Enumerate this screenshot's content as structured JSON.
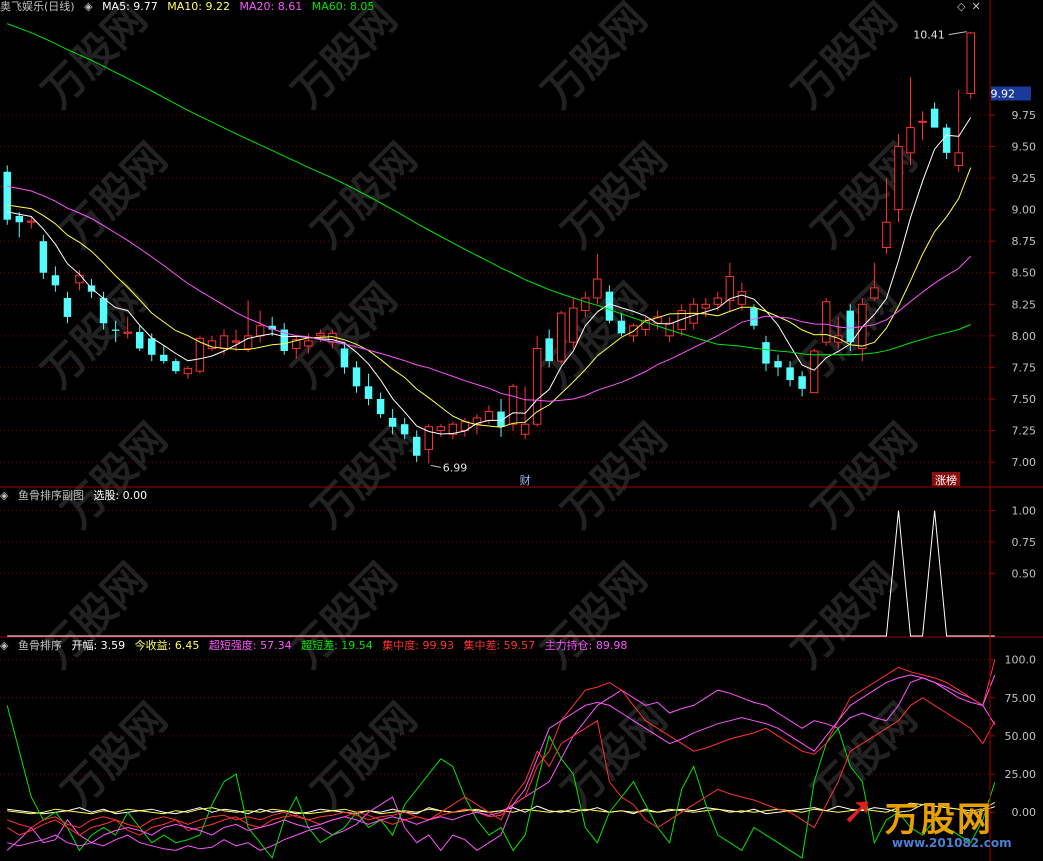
{
  "colors": {
    "up": "#ff3232",
    "down": "#54fcfc",
    "ma5": "#ffffff",
    "ma10": "#ffff54",
    "ma20": "#ff54ff",
    "ma60": "#00e600",
    "grid": "#7a0000",
    "frame": "#a00000",
    "axis": "#c0c0c0"
  },
  "header": {
    "title": "奥飞娱乐(日线)",
    "ma5": "MA5: 9.77",
    "ma10": "MA10: 9.22",
    "ma20": "MA20: 8.61",
    "ma60": "MA60: 8.05"
  },
  "price_axis": {
    "ticks": [
      "9.75",
      "9.50",
      "9.25",
      "9.00",
      "8.75",
      "8.50",
      "8.25",
      "8.00",
      "7.75",
      "7.50",
      "7.25",
      "7.00"
    ],
    "current": "9.92"
  },
  "annotations": {
    "high": "10.41",
    "low": "6.99",
    "finance_marker": "财",
    "limit_up_marker": "涨榜"
  },
  "panel2": {
    "title": "鱼骨排序副图",
    "field": "选股: 0.00",
    "ticks": [
      "1.00",
      "0.75",
      "0.50"
    ]
  },
  "panel3": {
    "title": "鱼骨排序",
    "items": [
      {
        "text": "开幅: 3.59",
        "color": "#ffffff"
      },
      {
        "text": "今收益: 6.45",
        "color": "#ffff54"
      },
      {
        "text": "超短强度: 57.34",
        "color": "#ff54ff"
      },
      {
        "text": "超短差: 19.54",
        "color": "#00e600"
      },
      {
        "text": "集中度: 99.93",
        "color": "#ff3232"
      },
      {
        "text": "集中差: 59.57",
        "color": "#ff3232"
      },
      {
        "text": "主力持仓: 89.98",
        "color": "#ff54ff"
      }
    ],
    "ticks": [
      "100.0",
      "75.00",
      "50.00",
      "25.00",
      "0.00"
    ]
  },
  "watermark": {
    "brand": "万股网",
    "url": "www.201082.com"
  },
  "chart_data": [
    {
      "type": "candlestick",
      "title": "奥飞娱乐(日线)",
      "ylim": [
        6.85,
        10.55
      ],
      "candles": [
        [
          9.3,
          9.35,
          8.88,
          8.92
        ],
        [
          8.95,
          8.98,
          8.78,
          8.9
        ],
        [
          8.9,
          8.95,
          8.85,
          8.91
        ],
        [
          8.75,
          8.8,
          8.45,
          8.5
        ],
        [
          8.48,
          8.55,
          8.35,
          8.4
        ],
        [
          8.3,
          8.35,
          8.1,
          8.15
        ],
        [
          8.42,
          8.52,
          8.36,
          8.48
        ],
        [
          8.4,
          8.45,
          8.3,
          8.35
        ],
        [
          8.3,
          8.35,
          8.05,
          8.1
        ],
        [
          8.05,
          8.12,
          7.95,
          8.04
        ],
        [
          8.02,
          8.15,
          7.98,
          8.03
        ],
        [
          8.03,
          8.08,
          7.88,
          7.9
        ],
        [
          7.98,
          8.02,
          7.8,
          7.85
        ],
        [
          7.85,
          7.92,
          7.78,
          7.8
        ],
        [
          7.8,
          7.82,
          7.7,
          7.72
        ],
        [
          7.7,
          7.76,
          7.66,
          7.74
        ],
        [
          7.72,
          8.0,
          7.7,
          7.98
        ],
        [
          7.9,
          8.0,
          7.88,
          7.96
        ],
        [
          7.9,
          8.05,
          7.85,
          8.0
        ],
        [
          7.95,
          8.05,
          7.88,
          7.96
        ],
        [
          7.9,
          8.28,
          7.87,
          8.0
        ],
        [
          8.0,
          8.2,
          7.95,
          8.08
        ],
        [
          8.08,
          8.15,
          8.0,
          8.05
        ],
        [
          8.05,
          8.1,
          7.85,
          7.88
        ],
        [
          7.9,
          8.0,
          7.82,
          7.97
        ],
        [
          7.92,
          8.02,
          7.86,
          7.96
        ],
        [
          8.0,
          8.05,
          7.95,
          8.02
        ],
        [
          7.95,
          8.05,
          7.9,
          8.02
        ],
        [
          7.9,
          7.95,
          7.7,
          7.75
        ],
        [
          7.75,
          7.8,
          7.55,
          7.6
        ],
        [
          7.6,
          7.7,
          7.45,
          7.5
        ],
        [
          7.5,
          7.55,
          7.35,
          7.38
        ],
        [
          7.35,
          7.42,
          7.22,
          7.28
        ],
        [
          7.3,
          7.35,
          7.18,
          7.22
        ],
        [
          7.2,
          7.25,
          7.0,
          7.05
        ],
        [
          7.1,
          7.3,
          6.99,
          7.28
        ],
        [
          7.25,
          7.3,
          7.2,
          7.28
        ],
        [
          7.22,
          7.32,
          7.18,
          7.3
        ],
        [
          7.25,
          7.35,
          7.2,
          7.32
        ],
        [
          7.3,
          7.38,
          7.22,
          7.35
        ],
        [
          7.33,
          7.45,
          7.3,
          7.4
        ],
        [
          7.4,
          7.5,
          7.2,
          7.28
        ],
        [
          7.3,
          7.62,
          7.25,
          7.6
        ],
        [
          7.22,
          7.6,
          7.18,
          7.3
        ],
        [
          7.3,
          8.0,
          7.28,
          7.9
        ],
        [
          7.98,
          8.05,
          7.75,
          7.8
        ],
        [
          7.8,
          8.2,
          7.78,
          8.18
        ],
        [
          7.95,
          8.3,
          7.9,
          8.22
        ],
        [
          8.2,
          8.35,
          8.15,
          8.3
        ],
        [
          8.3,
          8.65,
          8.25,
          8.45
        ],
        [
          8.35,
          8.4,
          8.1,
          8.12
        ],
        [
          8.12,
          8.18,
          8.0,
          8.02
        ],
        [
          8.0,
          8.1,
          7.95,
          8.08
        ],
        [
          8.05,
          8.15,
          8.0,
          8.12
        ],
        [
          8.1,
          8.2,
          8.05,
          8.15
        ],
        [
          8.0,
          8.15,
          7.95,
          8.1
        ],
        [
          8.05,
          8.25,
          8.0,
          8.2
        ],
        [
          8.1,
          8.3,
          8.05,
          8.25
        ],
        [
          8.22,
          8.3,
          8.15,
          8.25
        ],
        [
          8.25,
          8.35,
          8.2,
          8.3
        ],
        [
          8.28,
          8.58,
          8.2,
          8.47
        ],
        [
          8.25,
          8.42,
          8.2,
          8.35
        ],
        [
          8.22,
          8.25,
          8.05,
          8.08
        ],
        [
          7.95,
          8.0,
          7.72,
          7.78
        ],
        [
          7.8,
          7.85,
          7.68,
          7.75
        ],
        [
          7.75,
          7.8,
          7.6,
          7.65
        ],
        [
          7.68,
          7.72,
          7.52,
          7.58
        ],
        [
          7.55,
          7.9,
          7.55,
          7.88
        ],
        [
          7.95,
          8.3,
          7.92,
          8.27
        ],
        [
          7.95,
          8.15,
          7.9,
          8.0
        ],
        [
          8.2,
          8.25,
          7.88,
          7.95
        ],
        [
          7.9,
          8.3,
          7.8,
          8.25
        ],
        [
          8.3,
          8.58,
          8.28,
          8.38
        ],
        [
          8.7,
          9.25,
          8.65,
          8.9
        ],
        [
          9.0,
          9.6,
          8.9,
          9.5
        ],
        [
          9.45,
          10.05,
          9.35,
          9.65
        ],
        [
          9.7,
          9.78,
          9.55,
          9.7
        ],
        [
          9.8,
          9.85,
          9.65,
          9.65
        ],
        [
          9.65,
          9.68,
          9.4,
          9.45
        ],
        [
          9.35,
          9.95,
          9.3,
          9.45
        ],
        [
          9.92,
          10.41,
          9.88,
          10.4
        ]
      ]
    },
    {
      "type": "line",
      "title": "鱼骨排序副图",
      "ylim": [
        0,
        1.1
      ],
      "series": [
        {
          "name": "选股",
          "values": [
            0,
            0,
            0,
            0,
            0,
            0,
            0,
            0,
            0,
            0,
            0,
            0,
            0,
            0,
            0,
            0,
            0,
            0,
            0,
            0,
            0,
            0,
            0,
            0,
            0,
            0,
            0,
            0,
            0,
            0,
            0,
            0,
            0,
            0,
            0,
            0,
            0,
            0,
            0,
            0,
            0,
            0,
            0,
            0,
            0,
            0,
            0,
            0,
            0,
            0,
            0,
            0,
            0,
            0,
            0,
            0,
            0,
            0,
            0,
            0,
            0,
            0,
            0,
            0,
            0,
            0,
            0,
            0,
            0,
            0,
            0,
            0,
            0,
            0,
            1,
            0,
            0,
            1,
            0,
            0,
            0,
            0,
            0
          ]
        }
      ]
    },
    {
      "type": "line",
      "title": "鱼骨排序",
      "ylim": [
        -30,
        105
      ],
      "series": [
        {
          "name": "开幅",
          "values": [
            2,
            1,
            0,
            -1,
            0,
            1,
            3,
            0,
            2,
            -1,
            0,
            1,
            2,
            0,
            -1,
            1,
            3,
            0,
            2,
            1,
            -1,
            2,
            0,
            1,
            -1,
            0,
            2,
            1,
            0,
            -1,
            1,
            0,
            2,
            0,
            -1,
            3,
            1,
            0,
            2,
            1,
            0,
            1,
            3,
            0,
            4,
            1,
            0,
            2,
            1,
            3,
            0,
            1,
            -1,
            2,
            0,
            1,
            2,
            1,
            3,
            2,
            1,
            0,
            2,
            -1,
            0,
            1,
            2,
            3,
            1,
            4,
            2,
            1,
            3,
            2,
            0,
            1,
            5,
            4,
            3,
            2,
            -1,
            1,
            3.59
          ]
        },
        {
          "name": "今收益",
          "values": [
            1,
            0,
            -1,
            0,
            2,
            1,
            0,
            -1,
            1,
            0,
            2,
            1,
            0,
            -1,
            1,
            0,
            2,
            3,
            1,
            0,
            1,
            0,
            2,
            1,
            0,
            -1,
            0,
            1,
            2,
            0,
            1,
            -1,
            0,
            1,
            0,
            2,
            1,
            0,
            1,
            2,
            0,
            1,
            0,
            2,
            1,
            0,
            1,
            0,
            2,
            1,
            0,
            1,
            0,
            1,
            0,
            2,
            1,
            0,
            1,
            2,
            0,
            1,
            0,
            1,
            2,
            1,
            0,
            2,
            1,
            0,
            1,
            2,
            1,
            0,
            3,
            6,
            5,
            4,
            3,
            2,
            1,
            2,
            6.45
          ]
        },
        {
          "name": "超短强度",
          "values": [
            -25,
            -18,
            -10,
            -20,
            -18,
            -5,
            -15,
            -20,
            -22,
            -18,
            -15,
            -20,
            -22,
            -24,
            -25,
            -22,
            -24,
            -23,
            -18,
            -22,
            -20,
            -25,
            -22,
            -18,
            -15,
            -12,
            -10,
            -15,
            -12,
            -8,
            0,
            5,
            10,
            -10,
            -20,
            -15,
            -25,
            -15,
            -18,
            -25,
            -20,
            -15,
            5,
            10,
            15,
            20,
            35,
            50,
            60,
            70,
            75,
            80,
            75,
            70,
            72,
            65,
            68,
            70,
            75,
            80,
            78,
            75,
            72,
            70,
            65,
            60,
            55,
            60,
            58,
            55,
            62,
            65,
            62,
            60,
            70,
            85,
            88,
            85,
            82,
            78,
            75,
            70,
            57.34
          ]
        },
        {
          "name": "超短差",
          "values": [
            70,
            40,
            10,
            -5,
            0,
            -10,
            -25,
            -15,
            -10,
            -15,
            0,
            -10,
            -20,
            -15,
            -20,
            -18,
            -15,
            5,
            20,
            25,
            -10,
            -20,
            -30,
            -5,
            10,
            -10,
            -20,
            -15,
            -10,
            0,
            -10,
            -5,
            -15,
            5,
            15,
            25,
            35,
            30,
            10,
            -5,
            -15,
            -10,
            -25,
            -15,
            20,
            50,
            35,
            25,
            -10,
            -20,
            0,
            10,
            20,
            5,
            -10,
            -20,
            15,
            30,
            5,
            -15,
            -20,
            -25,
            -10,
            -15,
            -20,
            -25,
            -30,
            20,
            45,
            55,
            30,
            20,
            -20,
            -5,
            0,
            -10,
            -15,
            -5,
            -10,
            -15,
            -20,
            -5,
            19.54
          ]
        },
        {
          "name": "集中度",
          "values": [
            -10,
            -15,
            -12,
            -8,
            -5,
            -10,
            -15,
            -10,
            -8,
            -5,
            -12,
            -15,
            -10,
            -8,
            -5,
            -12,
            -10,
            -8,
            -5,
            -3,
            -8,
            -10,
            -5,
            -3,
            -2,
            -5,
            -8,
            -5,
            -3,
            0,
            -2,
            -5,
            -8,
            -5,
            -3,
            -5,
            -2,
            0,
            2,
            0,
            -3,
            -2,
            5,
            10,
            30,
            40,
            60,
            70,
            80,
            82,
            85,
            80,
            70,
            60,
            55,
            50,
            45,
            40,
            42,
            45,
            48,
            50,
            52,
            55,
            50,
            45,
            40,
            38,
            45,
            60,
            75,
            80,
            85,
            90,
            95,
            92,
            90,
            88,
            85,
            80,
            75,
            70,
            99.93
          ]
        },
        {
          "name": "集中差",
          "values": [
            -5,
            -8,
            -10,
            -5,
            -3,
            -8,
            -10,
            -5,
            -3,
            -5,
            -8,
            -10,
            -5,
            -3,
            -5,
            -8,
            -5,
            -3,
            -2,
            -5,
            -3,
            -5,
            -2,
            0,
            -3,
            -5,
            -3,
            -2,
            0,
            -2,
            -5,
            -3,
            -2,
            0,
            -3,
            -5,
            0,
            5,
            10,
            5,
            0,
            -5,
            10,
            20,
            40,
            30,
            45,
            50,
            55,
            60,
            20,
            10,
            5,
            -5,
            -10,
            -5,
            0,
            5,
            10,
            15,
            12,
            10,
            8,
            5,
            2,
            0,
            -5,
            -10,
            5,
            20,
            40,
            45,
            50,
            55,
            60,
            70,
            75,
            70,
            65,
            60,
            55,
            45,
            59.57
          ]
        },
        {
          "name": "主力持仓",
          "values": [
            -20,
            -22,
            -20,
            -18,
            -15,
            -20,
            -22,
            -20,
            -15,
            -12,
            -10,
            -12,
            -15,
            -10,
            -8,
            -10,
            -12,
            -15,
            -10,
            -8,
            -12,
            -10,
            -8,
            -5,
            -8,
            -10,
            -8,
            -5,
            -3,
            -5,
            -8,
            -5,
            -3,
            -5,
            -8,
            -5,
            -3,
            -5,
            -2,
            0,
            -2,
            0,
            5,
            15,
            35,
            55,
            60,
            65,
            70,
            72,
            70,
            65,
            60,
            55,
            50,
            45,
            48,
            52,
            55,
            58,
            60,
            62,
            60,
            58,
            55,
            50,
            45,
            40,
            50,
            60,
            70,
            75,
            80,
            85,
            88,
            90,
            88,
            85,
            80,
            75,
            72,
            70,
            89.98
          ]
        }
      ]
    }
  ]
}
